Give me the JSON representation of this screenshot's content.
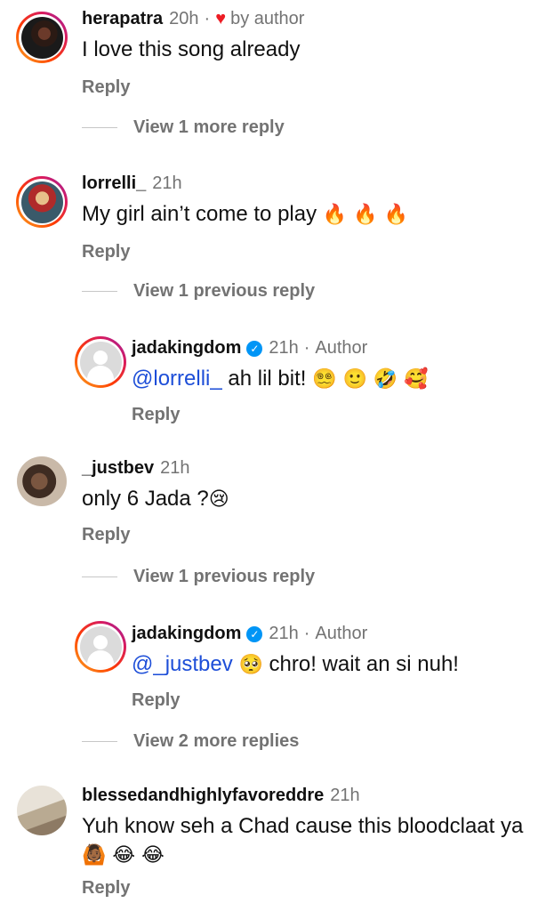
{
  "comments": [
    {
      "username": "herapatra",
      "time": "20h",
      "sep": "·",
      "liked_by_author": "by author",
      "text": "I love this song already",
      "reply": "Reply",
      "view_more": "View 1 more reply"
    },
    {
      "username": "lorrelli_",
      "time": "21h",
      "text": "My girl ain’t come to play",
      "emojis": "🔥 🔥 🔥",
      "reply": "Reply",
      "view_more": "View 1 previous reply"
    },
    {
      "username": "jadakingdom",
      "verified": "✓",
      "time": "21h",
      "sep": "·",
      "author_label": "Author",
      "mention": "@lorrelli_",
      "text": "ah lil bit!",
      "emojis": "😵‍💫 🙂 🤣 🥰",
      "reply": "Reply"
    },
    {
      "username": "_justbev",
      "time": "21h",
      "text": "only 6 Jada ?",
      "emojis": "😢",
      "reply": "Reply",
      "view_more": "View 1 previous reply"
    },
    {
      "username": "jadakingdom",
      "verified": "✓",
      "time": "21h",
      "sep": "·",
      "author_label": "Author",
      "mention": "@_justbev",
      "emojis": "🥺",
      "text": "chro! wait an si nuh!",
      "reply": "Reply",
      "view_more": "View 2 more replies"
    },
    {
      "username": "blessedandhighlyfavoreddre",
      "time": "21h",
      "text": "Yuh know seh a Chad cause this bloodclaat ya",
      "emojis": "🙆🏾 😂 😂",
      "reply": "Reply"
    }
  ],
  "colors": {
    "heart": "#ed1c24",
    "mention": "#1d4ed8",
    "verified": "#0095f6",
    "secondary_text": "#737373"
  }
}
